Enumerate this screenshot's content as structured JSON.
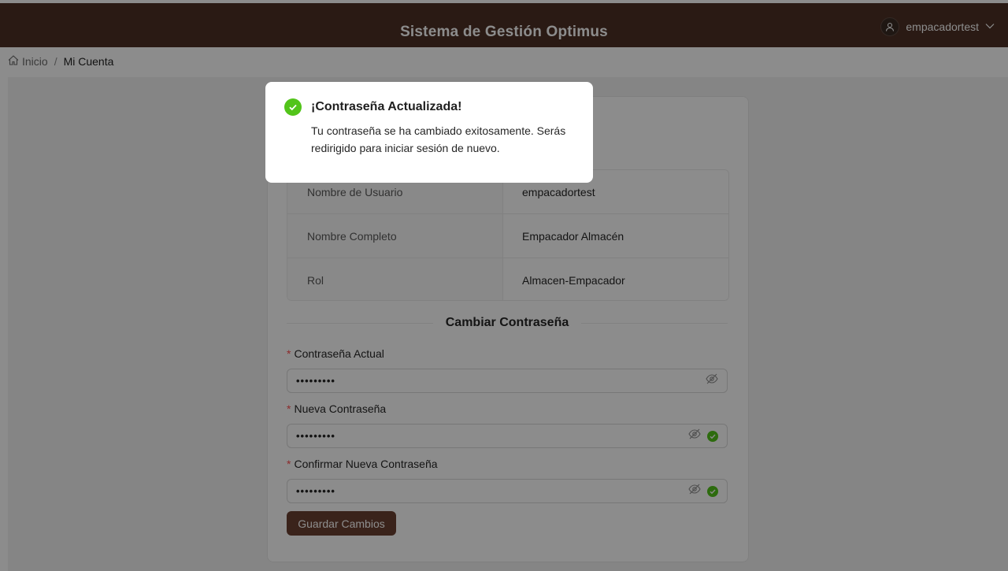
{
  "header": {
    "title": "Sistema de Gestión Optimus",
    "username": "empacadortest"
  },
  "breadcrumb": {
    "home": "Inicio",
    "separator": "/",
    "current": "Mi Cuenta"
  },
  "account": {
    "rows": [
      {
        "label": "Nombre de Usuario",
        "value": "empacadortest"
      },
      {
        "label": "Nombre Completo",
        "value": "Empacador Almacén"
      },
      {
        "label": "Rol",
        "value": "Almacen-Empacador"
      }
    ]
  },
  "password_form": {
    "section_title": "Cambiar Contraseña",
    "required_mark": "*",
    "current_label": "Contraseña Actual",
    "current_value": "•••••••••",
    "new_label": "Nueva Contraseña",
    "new_value": "•••••••••",
    "confirm_label": "Confirmar Nueva Contraseña",
    "confirm_value": "•••••••••",
    "save_label": "Guardar Cambios"
  },
  "modal": {
    "title": "¡Contraseña Actualizada!",
    "message": "Tu contraseña se ha cambiado exitosamente. Serás redirigido para iniciar sesión de nuevo.",
    "icon": "check-circle-icon"
  },
  "colors": {
    "header_bg": "#4d3026",
    "primary_button": "#6b4132",
    "success": "#52c41a",
    "required": "#ff4d4f"
  }
}
